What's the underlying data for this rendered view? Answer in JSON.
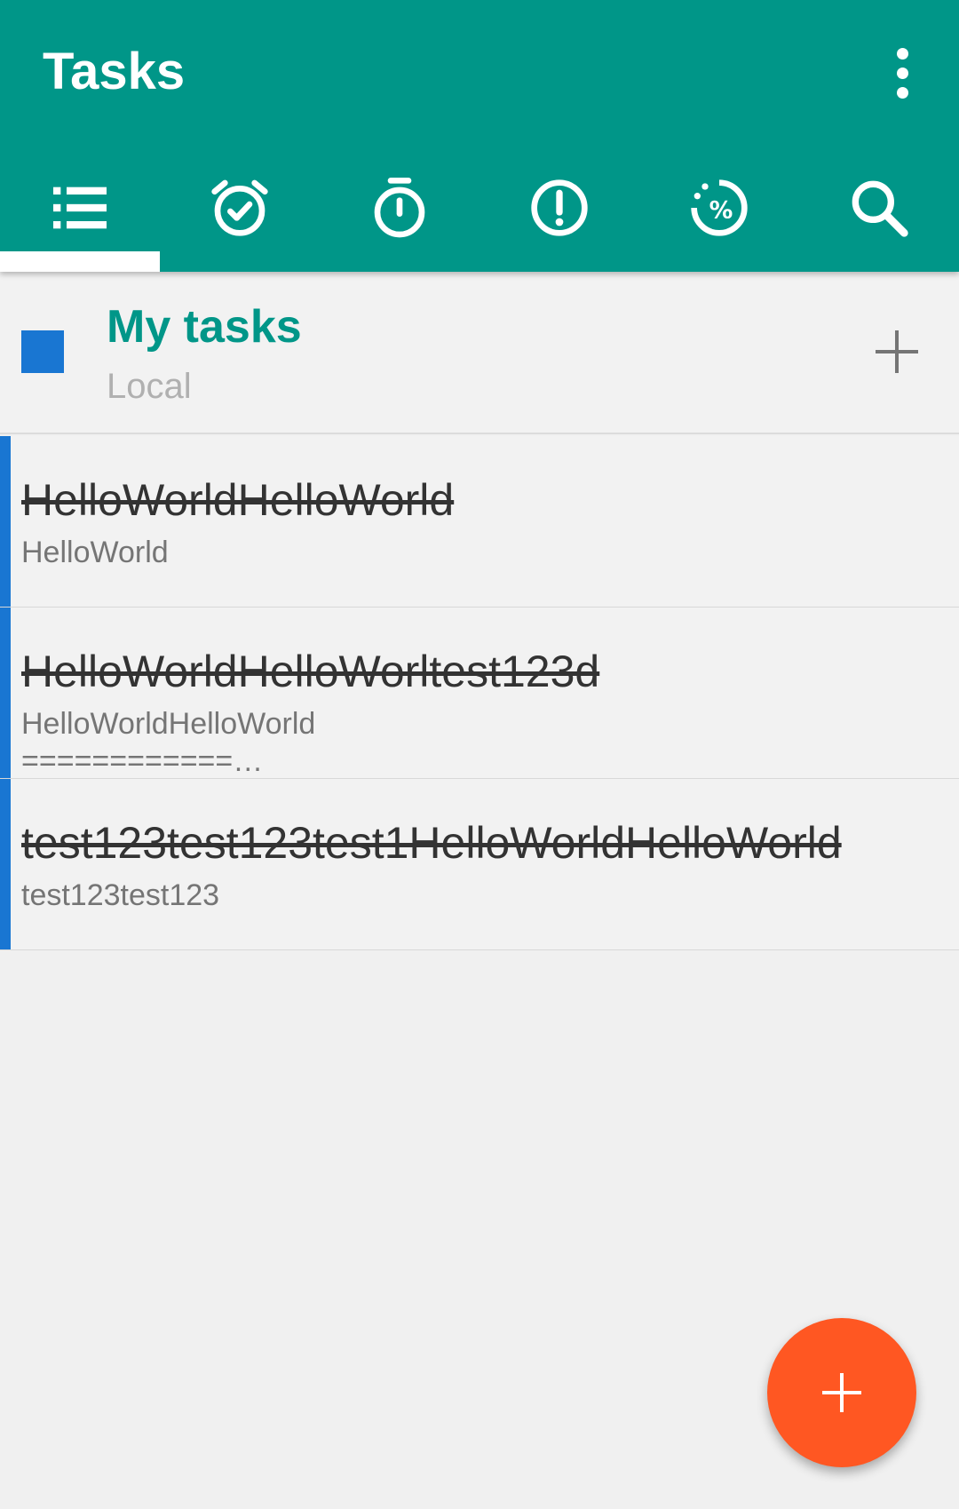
{
  "appbar": {
    "title": "Tasks",
    "overflow_icon": "more-vert-icon",
    "background_color": "#009688"
  },
  "tabs": [
    {
      "icon": "list-icon",
      "selected": true
    },
    {
      "icon": "alarm-check-icon",
      "selected": false
    },
    {
      "icon": "timer-icon",
      "selected": false
    },
    {
      "icon": "priority-icon",
      "selected": false
    },
    {
      "icon": "progress-percent-icon",
      "selected": false
    },
    {
      "icon": "search-icon",
      "selected": false
    }
  ],
  "list_header": {
    "name": "My tasks",
    "account": "Local",
    "color": "#1976d2",
    "add_icon": "plus-icon"
  },
  "tasks": [
    {
      "title": "HelloWorldHelloWorld",
      "notes": "HelloWorld",
      "completed": true
    },
    {
      "title": "HelloWorldHelloWorltest123d",
      "notes": "HelloWorldHelloWorld\n============…",
      "completed": true
    },
    {
      "title": "test123test123test1HelloWorldHelloWorld",
      "notes": "test123test123",
      "completed": true
    }
  ],
  "fab": {
    "icon": "plus-icon",
    "color": "#ff5722"
  }
}
